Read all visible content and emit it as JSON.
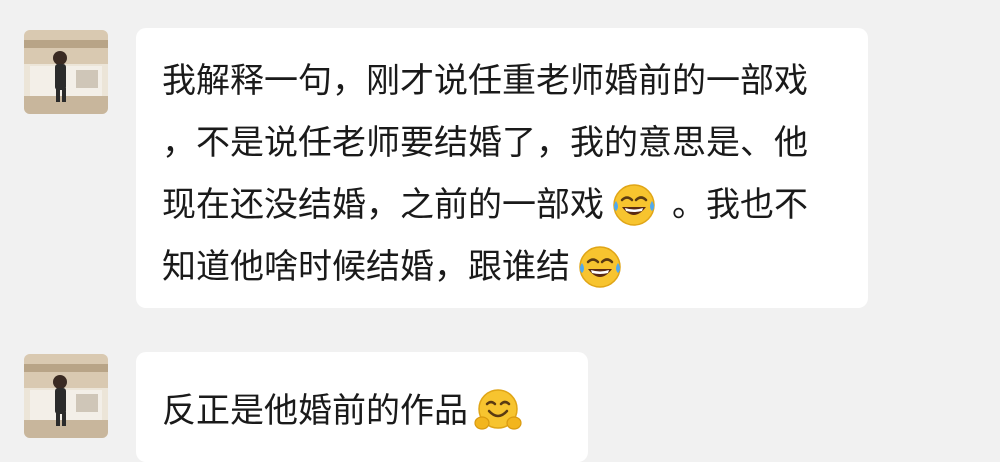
{
  "messages": [
    {
      "sender_avatar": "user-avatar",
      "lines": [
        {
          "text": "我解释一句，刚才说任重老师婚前的一部戏"
        },
        {
          "text": "，不是说任老师要结婚了，我的意思是、他"
        },
        {
          "text_before": "现在还没结婚，之前的一部戏",
          "emoji": "tears-of-joy-emoji",
          "text_after": "。我也不"
        },
        {
          "text_before": "知道他啥时候结婚，跟谁结",
          "emoji": "tears-of-joy-emoji"
        }
      ]
    },
    {
      "sender_avatar": "user-avatar",
      "lines": [
        {
          "text_before": "反正是他婚前的作品",
          "emoji": "hugging-face-emoji"
        }
      ]
    }
  ],
  "colors": {
    "background": "#f1f1f1",
    "bubble": "#ffffff",
    "text": "#1a1a1a"
  }
}
